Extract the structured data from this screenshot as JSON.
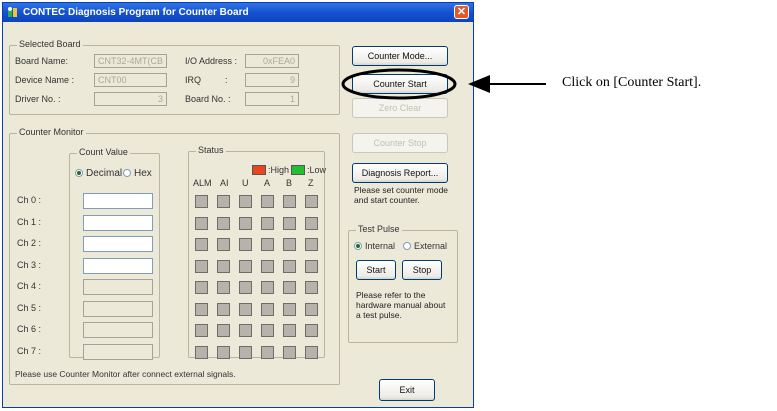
{
  "window": {
    "title": "CONTEC Diagnosis Program for Counter Board",
    "close_glyph": "✕"
  },
  "selected_board": {
    "title": "Selected Board",
    "board_name_label": "Board Name:",
    "board_name_value": "CNT32-4MT(CB",
    "io_address_label": "I/O Address :",
    "io_address_value": "0xFEA0",
    "device_name_label": "Device Name :",
    "device_name_value": "CNT00",
    "irq_label": "IRQ",
    "irq_colon": ":",
    "irq_value": "9",
    "driver_no_label": "Driver No. :",
    "driver_no_value": "3",
    "board_no_label": "Board No. :",
    "board_no_value": "1"
  },
  "counter_monitor": {
    "title": "Counter Monitor",
    "count_value_title": "Count Value",
    "radio_decimal": "Decimal",
    "radio_hex": "Hex",
    "decimal_selected": true,
    "channels": [
      "Ch 0 :",
      "Ch 1 :",
      "Ch 2 :",
      "Ch 3 :",
      "Ch 4 :",
      "Ch 5 :",
      "Ch 6 :",
      "Ch 7 :"
    ],
    "active_channels": 4,
    "status_title": "Status",
    "legend_high": ":High",
    "legend_low": ":Low",
    "legend_high_color": "#e8461e",
    "legend_low_color": "#22c030",
    "status_columns": [
      "ALM",
      "AI",
      "U",
      "A",
      "B",
      "Z"
    ],
    "footer_note": "Please use Counter Monitor after connect external signals."
  },
  "buttons": {
    "counter_mode": "Counter Mode...",
    "counter_start": "Counter Start",
    "zero_clear": "Zero Clear",
    "counter_stop": "Counter Stop",
    "diagnosis_report": "Diagnosis Report...",
    "exit": "Exit"
  },
  "side_note": "Please set counter mode and start counter.",
  "test_pulse": {
    "title": "Test Pulse",
    "radio_internal": "Internal",
    "radio_external": "External",
    "internal_selected": true,
    "start": "Start",
    "stop": "Stop",
    "note": "Please refer to the hardware manual about a test pulse."
  },
  "annotation": {
    "text": "Click on [Counter Start]."
  }
}
